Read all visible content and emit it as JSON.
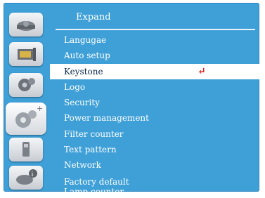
{
  "title": "Expand",
  "sidebar": {
    "icons": [
      "display-icon",
      "picture-settings-icon",
      "settings-gears-icon",
      "expand-gears-icon",
      "usb-icon",
      "info-icon"
    ],
    "active_index": 3
  },
  "menu": {
    "items": [
      {
        "label": "Langugae"
      },
      {
        "label": "Auto setup"
      },
      {
        "label": "Keystone"
      },
      {
        "label": "Logo"
      },
      {
        "label": "Security"
      },
      {
        "label": "Power management"
      },
      {
        "label": "Filter counter"
      },
      {
        "label": "Text pattern"
      },
      {
        "label": "Network"
      },
      {
        "label": "Factory default"
      },
      {
        "label": "Lamp counter"
      }
    ],
    "selected_index": 2,
    "enter_glyph": "↵"
  },
  "colors": {
    "panel": "#3fa0d8",
    "selected_bg": "#ffffff",
    "enter_icon": "#e02020"
  }
}
